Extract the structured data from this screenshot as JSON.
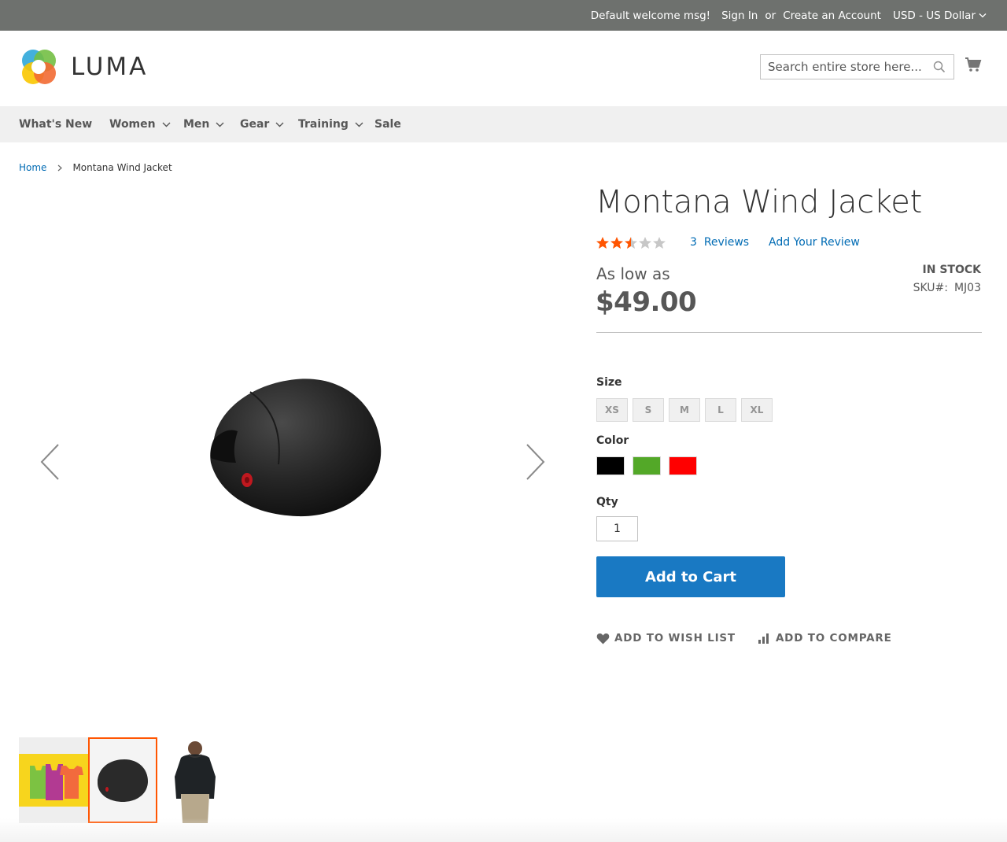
{
  "top_bar": {
    "welcome": "Default welcome msg!",
    "sign_in": "Sign In",
    "or": "or",
    "create_account": "Create an Account",
    "currency": "USD - US Dollar"
  },
  "header": {
    "logo_text": "LUMA",
    "search_placeholder": "Search entire store here...",
    "search_value": ""
  },
  "nav": {
    "items": [
      {
        "label": "What's New",
        "has_dropdown": false
      },
      {
        "label": "Women",
        "has_dropdown": true
      },
      {
        "label": "Men",
        "has_dropdown": true
      },
      {
        "label": "Gear",
        "has_dropdown": true
      },
      {
        "label": "Training",
        "has_dropdown": true
      },
      {
        "label": "Sale",
        "has_dropdown": false
      }
    ]
  },
  "breadcrumb": {
    "home": "Home",
    "current": "Montana Wind Jacket"
  },
  "product": {
    "name": "Montana Wind Jacket",
    "rating": 2.5,
    "rating_max": 5,
    "reviews_count": "3",
    "reviews_label": "Reviews",
    "add_review": "Add Your Review",
    "price_prefix": "As low as",
    "price": "$49.00",
    "stock": "IN STOCK",
    "sku_label": "SKU#:",
    "sku": "MJ03",
    "size_label": "Size",
    "sizes": [
      "XS",
      "S",
      "M",
      "L",
      "XL"
    ],
    "color_label": "Color",
    "colors": [
      {
        "name": "Black",
        "hex": "#000000"
      },
      {
        "name": "Green",
        "hex": "#53a828"
      },
      {
        "name": "Red",
        "hex": "#ff0000"
      }
    ],
    "qty_label": "Qty",
    "qty": "1",
    "add_to_cart": "Add to Cart",
    "wishlist": "ADD TO WISH LIST",
    "compare": "ADD TO COMPARE"
  },
  "gallery": {
    "active_index": 1,
    "thumbnails": [
      "colorful tank tops image",
      "black ball image",
      "jacket back view image"
    ]
  },
  "colors": {
    "top_bar_bg": "#6e716e",
    "nav_bg": "#f0f0f0",
    "link": "#006bb4",
    "primary_button": "#1979c3",
    "star_active": "#ff5501",
    "star_inactive": "#c7c7c7",
    "active_thumb_border": "#ff5501"
  },
  "icons": {
    "search": "search-icon",
    "cart": "cart-icon",
    "chevron": "chevron-down-icon",
    "prev": "chevron-left-icon",
    "next": "chevron-right-icon",
    "wishlist": "heart-icon",
    "compare": "bar-chart-icon"
  }
}
